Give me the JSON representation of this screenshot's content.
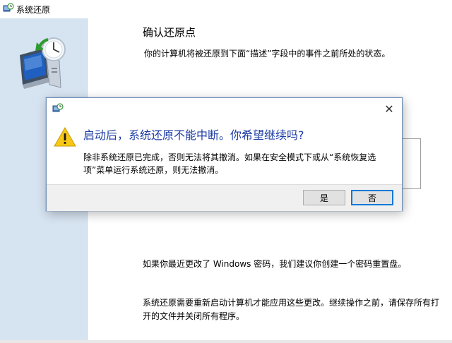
{
  "window": {
    "title": "系统还原",
    "heading": "确认还原点",
    "description": "你的计算机将被还原到下面“描述”字段中的事件之前所处的状态。",
    "password_note": "如果你最近更改了 Windows 密码，我们建议你创建一个密码重置盘。",
    "restart_note": "系统还原需要重新启动计算机才能应用这些更改。继续操作之前，请保存所有打开的文件并关闭所有程序。"
  },
  "dialog": {
    "main_instruction": "启动后，系统还原不能中断。你希望继续吗?",
    "body": "除非系统还原已完成，否则无法将其撤消。如果在安全模式下或从“系统恢复选项”菜单运行系统还原，则无法撤消。",
    "yes_label": "是",
    "no_label": "否",
    "close_glyph": "✕"
  },
  "colors": {
    "sidebar": "#d6e3f0",
    "instruction_text": "#1e3da6",
    "footer": "#f0f0f0",
    "focus_border": "#0078d7"
  },
  "icons": {
    "app": "system-restore-icon",
    "large": "computer-clock-icon",
    "warning": "warning-triangle-icon",
    "close": "close-icon"
  }
}
